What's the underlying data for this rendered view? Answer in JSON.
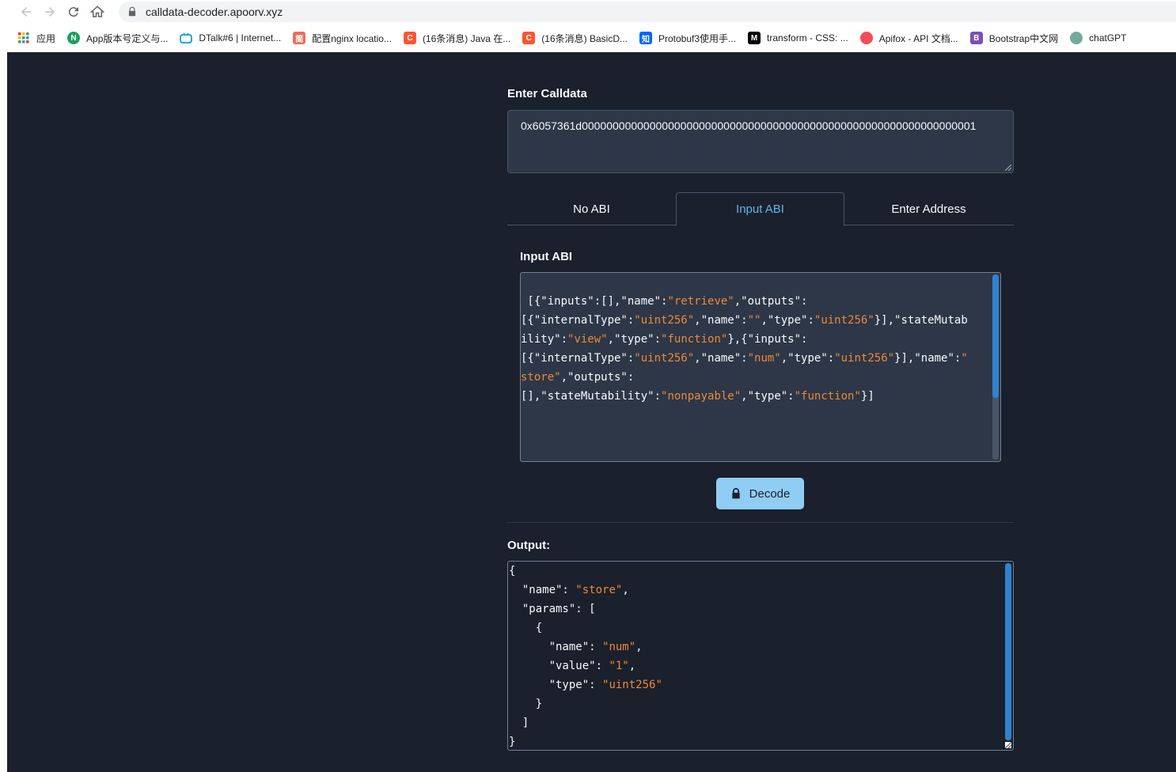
{
  "browser": {
    "url": "calldata-decoder.apoorv.xyz",
    "bookmarks": [
      {
        "label": "应用",
        "icon": "apps-grid-icon",
        "color": "#4285f4"
      },
      {
        "label": "App版本号定义与...",
        "icon": "n-badge-icon",
        "color": "#1aa260"
      },
      {
        "label": "DTalk#6 | Internet...",
        "icon": "bilibili-icon",
        "color": "#00a1d6"
      },
      {
        "label": "配置nginx locatio...",
        "icon": "jian-icon",
        "color": "#ea6f5a"
      },
      {
        "label": "(16条消息) Java 在...",
        "icon": "csdn-icon",
        "color": "#fc5531"
      },
      {
        "label": "(16条消息) BasicD...",
        "icon": "csdn-icon",
        "color": "#fc5531"
      },
      {
        "label": "Protobuf3使用手...",
        "icon": "zhihu-icon",
        "color": "#0066ff"
      },
      {
        "label": "transform - CSS: ...",
        "icon": "mdn-icon",
        "color": "#000000"
      },
      {
        "label": "Apifox - API 文档...",
        "icon": "apifox-icon",
        "color": "#f44a5a"
      },
      {
        "label": "Bootstrap中文网",
        "icon": "bootstrap-icon",
        "color": "#7952b3"
      },
      {
        "label": "chatGPT",
        "icon": "openai-icon",
        "color": "#74aa9c"
      }
    ]
  },
  "calldata": {
    "label": "Enter Calldata",
    "value": "0x6057361d0000000000000000000000000000000000000000000000000000000000000001"
  },
  "tabs": [
    {
      "label": "No ABI",
      "active": false
    },
    {
      "label": "Input ABI",
      "active": true
    },
    {
      "label": "Enter Address",
      "active": false
    }
  ],
  "abi": {
    "label": "Input ABI"
  },
  "decode_button": {
    "label": "Decode"
  },
  "output": {
    "label": "Output:"
  }
}
